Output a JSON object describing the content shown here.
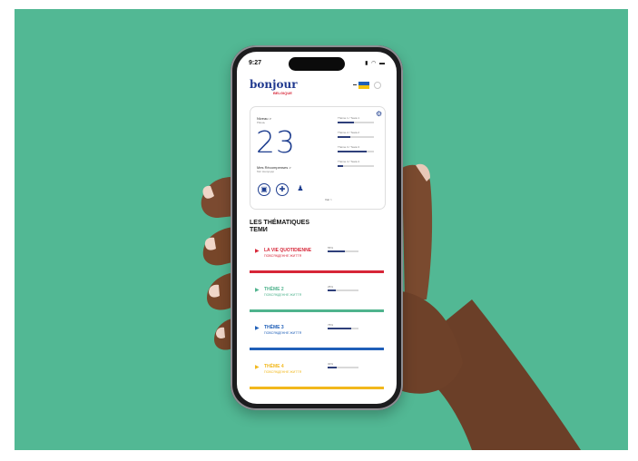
{
  "status": {
    "time": "9:27",
    "icons": "signal-wifi-battery"
  },
  "brand": {
    "logo": "bonjour",
    "sub": "BELGIQUE"
  },
  "card": {
    "niveau_label": "Niveau >",
    "niveau_sub": "Рівень",
    "level": "23",
    "rewards_label": "Mes Récompenses >",
    "rewards_sub": "Мої Нагороди",
    "see_all": "Voir >",
    "progress": [
      {
        "label": "Thème 1 / Тема 1",
        "value": 0.45
      },
      {
        "label": "Thème 2 / Тема 2",
        "value": 0.35
      },
      {
        "label": "Thème 3 / Тема 3",
        "value": 0.8
      },
      {
        "label": "Thème 4 / Тема 4",
        "value": 0.15
      }
    ],
    "icons": [
      "train-icon",
      "medical-cross-icon",
      "desk-person-icon"
    ]
  },
  "themes_heading": {
    "fr": "LES THÉMATIQUES",
    "uk": "ТЕМИ"
  },
  "themes": [
    {
      "title": "LA VIE QUOTIDIENNE",
      "sub": "ПОВСЯКДЕННЕ ЖИТТЯ",
      "pct": "55%",
      "value": 0.55,
      "color": "#d72638"
    },
    {
      "title": "THÈME 2",
      "sub": "ПОВСЯКДЕННЕ ЖИТТЯ",
      "pct": "25%",
      "value": 0.25,
      "color": "#4fb38d"
    },
    {
      "title": "THÈME 3",
      "sub": "ПОВСЯКДЕННЕ ЖИТТЯ",
      "pct": "75%",
      "value": 0.75,
      "color": "#1f5fb8"
    },
    {
      "title": "THÈME 4",
      "sub": "ПОВСЯКДЕННЕ ЖИТТЯ",
      "pct": "30%",
      "value": 0.3,
      "color": "#f2b81d"
    }
  ],
  "colors": {
    "background": "#52b894",
    "brand_blue": "#1d3d8f",
    "brand_red": "#d72638"
  }
}
